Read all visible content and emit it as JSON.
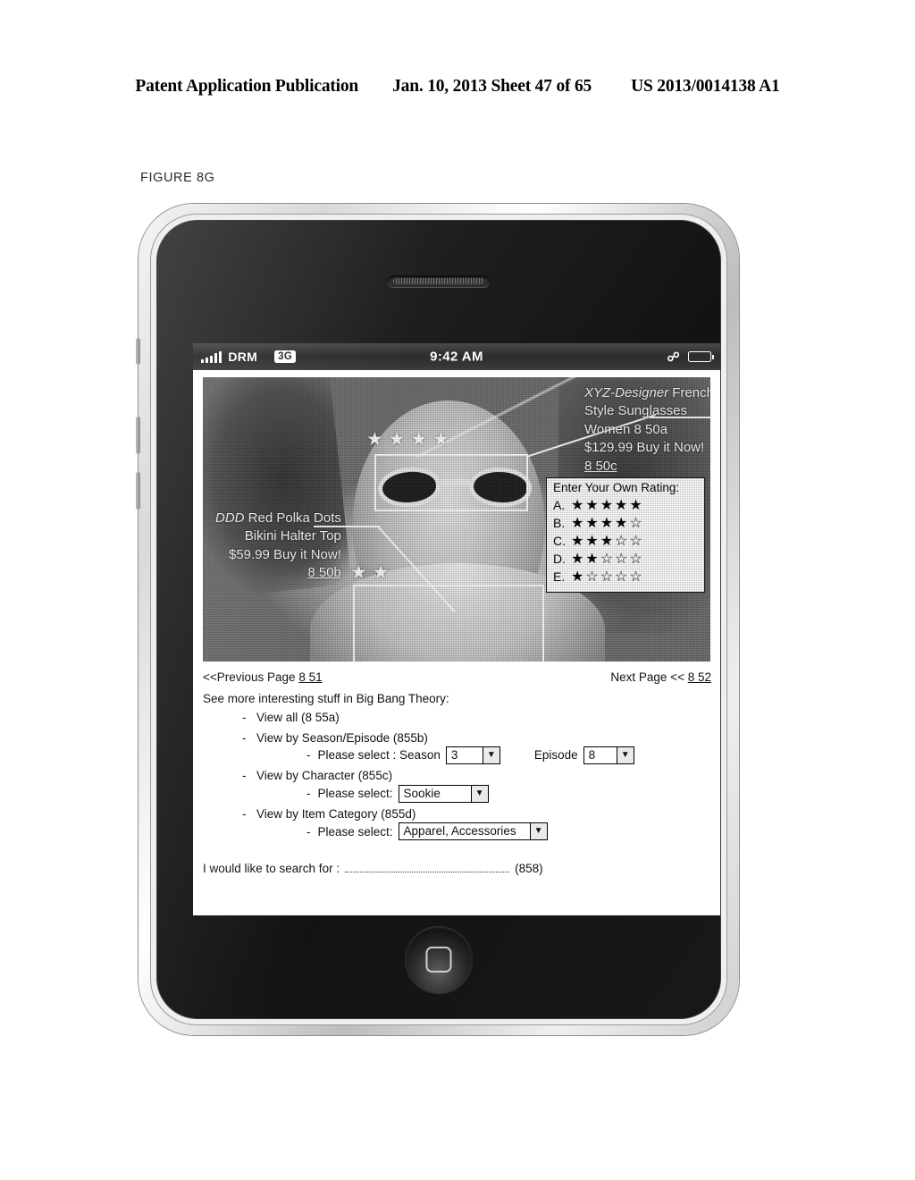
{
  "patent_header": {
    "publication": "Patent Application Publication",
    "date_sheet": "Jan. 10, 2013  Sheet 47 of 65",
    "number": "US 2013/0014138 A1"
  },
  "figure_label": "FIGURE 8G",
  "status_bar": {
    "carrier": "DRM",
    "network": "3G",
    "time": "9:42 AM",
    "bluetooth_icon": "bluetooth-icon",
    "battery_icon": "battery-icon",
    "signal_icon": "signal-bars-icon"
  },
  "photo": {
    "sunglasses_callout": {
      "brand": "XYZ-Designer",
      "line1_rest": " French",
      "line2": "Style Sunglasses",
      "line3": "Women 8 50a",
      "line4": "$129.99  Buy it Now!",
      "ref_link": "8 50c",
      "star_rating": "★ ★ ★ ★"
    },
    "bikini_callout": {
      "brand": "DDD",
      "line1_rest": " Red Polka Dots",
      "line2": "Bikini Halter Top",
      "line3": "$59.99 Buy it Now!",
      "ref_link": "8 50b",
      "star_rating": "★ ★"
    }
  },
  "rating_box": {
    "title": "Enter Your Own Rating:",
    "options": [
      {
        "label": "A.",
        "stars": "★★★★★",
        "value": 5
      },
      {
        "label": "B.",
        "stars": "★★★★☆",
        "value": 4
      },
      {
        "label": "C.",
        "stars": "★★★☆☆",
        "value": 3
      },
      {
        "label": "D.",
        "stars": "★★☆☆☆",
        "value": 2
      },
      {
        "label": "E.",
        "stars": "★☆☆☆☆",
        "value": 1
      }
    ]
  },
  "pager": {
    "previous": "<<Previous Page",
    "previous_ref": "8 51",
    "next": "Next Page <<",
    "next_ref": "8 52"
  },
  "browse": {
    "intro": "See more interesting stuff in Big Bang Theory:",
    "items": [
      {
        "label": "View all (8 55a)"
      },
      {
        "label": "View by Season/Episode (855b)"
      },
      {
        "label": "View by Character (855c)"
      },
      {
        "label": "View by Item Category (855d)"
      }
    ],
    "season_row": {
      "prefix": "Please select : Season",
      "season_value": "3",
      "episode_label": "Episode",
      "episode_value": "8",
      "arrow_glyph": "▼"
    },
    "character_row": {
      "prefix": "Please select:",
      "value": "Sookie",
      "arrow_glyph": "▼"
    },
    "category_row": {
      "prefix": "Please select:",
      "value": "Apparel, Accessories",
      "arrow_glyph": "▼"
    }
  },
  "search": {
    "label": "I would like to search for :",
    "value": "",
    "ref": "(858)"
  },
  "device": {
    "home_button": "home-button",
    "earpiece": "earpiece-speaker"
  }
}
